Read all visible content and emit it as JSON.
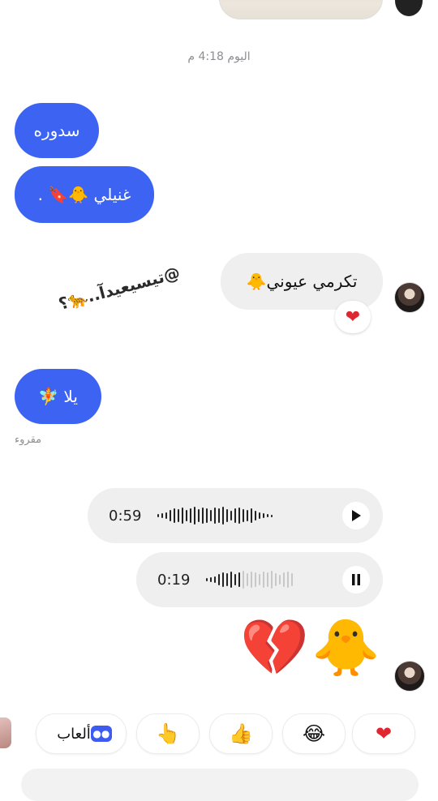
{
  "timestamp": "اليوم 4:18 م",
  "messages": {
    "out1": "سدوره",
    "out2": "غنيلي 🐥🔖 .",
    "in1": "تكرمي عيوني🐥",
    "in1_reaction": "❤",
    "sticker_text": "@تيسيعيدآ..🐆؟",
    "out3": "يلا 🧚",
    "read_status": "مقروء"
  },
  "voice_notes": [
    {
      "duration": "0:59",
      "state": "play",
      "progress": 1.0
    },
    {
      "duration": "0:19",
      "state": "pause",
      "progress": 0.4
    }
  ],
  "big_emojis": {
    "chick": "🐥",
    "broken_heart": "💔"
  },
  "quick_replies": {
    "games_label": "ألعاب",
    "games_icon": "🎮",
    "pointing": "👆",
    "thumbs_up": "👍",
    "laughing": "😂",
    "heart": "❤"
  },
  "colors": {
    "accent": "#3d63f2",
    "received_bg": "#efefef",
    "heart": "#e0262f"
  }
}
